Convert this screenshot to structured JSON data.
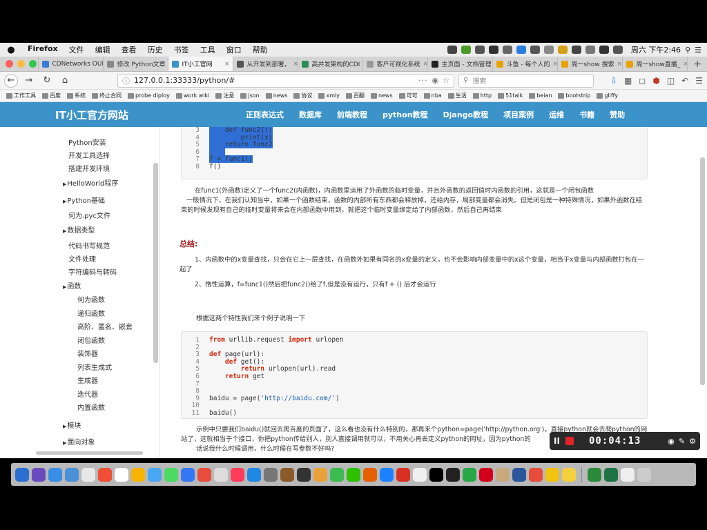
{
  "menubar": {
    "apple": "",
    "items": [
      "Firefox",
      "文件",
      "编辑",
      "查看",
      "历史",
      "书签",
      "工具",
      "窗口",
      "帮助"
    ],
    "clock": "周六 下午2:46",
    "tray_colors": [
      "#444",
      "#4c9a2a",
      "#555",
      "#333",
      "#666",
      "#2b7de0",
      "#555",
      "#888",
      "#d4a017",
      "#444",
      "#777",
      "#333",
      "#555"
    ]
  },
  "tabs": [
    {
      "label": "CDNetworks OUI",
      "color": "#3a7bd5"
    },
    {
      "label": "修改 Python文章 | D",
      "color": "#888"
    },
    {
      "label": "IT小工官网",
      "color": "#3b93c9",
      "active": true
    },
    {
      "label": "从开发到部署，",
      "color": "#555"
    },
    {
      "label": "高并发架构的CDI",
      "color": "#2e8b57"
    },
    {
      "label": "客户可视化系统",
      "color": "#999"
    },
    {
      "label": "主页面 - 文档管理",
      "color": "#222"
    },
    {
      "label": "斗鱼 - 每个人的",
      "color": "#e8a400"
    },
    {
      "label": "周一show 搜索",
      "color": "#e8a400"
    },
    {
      "label": "周一show直播_",
      "color": "#e8a400"
    }
  ],
  "nav": {
    "url": "127.0.0.1:33333/python/#",
    "url_more": "···",
    "search_placeholder": "搜索"
  },
  "bookmarks": [
    "工作工具",
    "百度",
    "系统",
    "终止合同",
    "probe diploy",
    "work wiki",
    "注意",
    "json",
    "news",
    "协议",
    "xmly",
    "百翻",
    "news",
    "可可",
    "nba",
    "生活",
    "http",
    "51talk",
    "beian",
    "bootstrip",
    "gliffy"
  ],
  "site": {
    "title": "IT小工官方网站",
    "nav": [
      "正则表达式",
      "数据库",
      "前端教程",
      "python教程",
      "Django教程",
      "项目案例",
      "运维",
      "书籍",
      "赞助"
    ]
  },
  "sidebar": [
    {
      "label": "Python安装",
      "type": "sub"
    },
    {
      "label": "开发工具选择",
      "type": "sub"
    },
    {
      "label": "搭建开发环境",
      "type": "sub"
    },
    {
      "label": "HelloWorld程序",
      "type": "group"
    },
    {
      "label": "Python基础",
      "type": "group"
    },
    {
      "label": "何为.pyc文件",
      "type": "sub"
    },
    {
      "label": "数据类型",
      "type": "group"
    },
    {
      "label": "代码书写规范",
      "type": "sub"
    },
    {
      "label": "文件处理",
      "type": "sub"
    },
    {
      "label": "字符编码与转码",
      "type": "sub"
    },
    {
      "label": "函数",
      "type": "group"
    },
    {
      "label": "何为函数",
      "type": "sub2"
    },
    {
      "label": "递归函数",
      "type": "sub2"
    },
    {
      "label": "高阶、匿名、嵌套",
      "type": "sub2"
    },
    {
      "label": "闭包函数",
      "type": "sub2"
    },
    {
      "label": "装饰器",
      "type": "sub2"
    },
    {
      "label": "列表生成式",
      "type": "sub2"
    },
    {
      "label": "生成器",
      "type": "sub2"
    },
    {
      "label": "迭代器",
      "type": "sub2"
    },
    {
      "label": "内置函数",
      "type": "sub2"
    },
    {
      "label": "模块",
      "type": "group"
    },
    {
      "label": "面向对象",
      "type": "group"
    }
  ],
  "code1": {
    "lines": [
      {
        "n": "3",
        "text": "    def func2():",
        "hl": true
      },
      {
        "n": "4",
        "text": "        print(x)",
        "hl": true
      },
      {
        "n": "5",
        "text": "    return func2",
        "hl": true
      },
      {
        "n": "6",
        "text": "    ",
        "hl": true
      },
      {
        "n": "7",
        "text": "f = func1()",
        "hl": true
      },
      {
        "n": "8",
        "text": "f()",
        "hl": false
      }
    ]
  },
  "para1": "在func1(外函数)定义了一个func2(内函数)，内函数里运用了外函数的临时变量，并且外函数的返回值时内函数的引用，这就是一个闭包函数",
  "para2": "一般情况下，在我们认知当中，如果一个函数结束，函数的内部所有东西都会释放掉，还给内存，局部变量都会消失。但是闭包是一种特殊情况，如果外函数在结束的时候发现有自己的临时变量将来会在内部函数中用到，就把这个临时变量绑定给了内部函数，然后自己再结束",
  "summary_title": "总结:",
  "summary1": "1、内函数中的x变量查找，只会在它上一层查找，在函数外如果有同名的x变量的定义，也不会影响内部变量中的x这个变量，相当于x变量与内部函数打包在一起了",
  "summary2": "2、惰性运算，f=func1()然后把func2()给了f,但是没有运行，只有f + () 后才会运行",
  "example_intro": "根据这两个特性我们来个例子说明一下",
  "code2": {
    "lines": [
      {
        "n": "1",
        "text": "from urllib.request import urlopen"
      },
      {
        "n": "2",
        "text": ""
      },
      {
        "n": "3",
        "text": "def page(url):"
      },
      {
        "n": "4",
        "text": "    def get():"
      },
      {
        "n": "5",
        "text": "        return urlopen(url).read"
      },
      {
        "n": "6",
        "text": "    return get"
      },
      {
        "n": "7",
        "text": ""
      },
      {
        "n": "8",
        "text": ""
      },
      {
        "n": "9",
        "text": "baidu = page('http://baidu.com/')"
      },
      {
        "n": "10",
        "text": ""
      },
      {
        "n": "11",
        "text": "baidu()"
      }
    ]
  },
  "bottom_para1": "示例中只要我们baidu()就回去爬百度的页面了，这么看也没有什么特别的，那再来个python=page('http://python.org')，直接python就会去爬python的网站了，这就相当于个接口，你把python传给别人，别人直接调用就可以，不用关心再去定义python的网址，因为python的",
  "bottom_para2": "话说我什么时候调用，什么时候在写参数不好吗?",
  "recorder": {
    "time": "00:04:13",
    "pause": "II"
  },
  "dock_colors": [
    "#2b6fd1",
    "#6a4bbf",
    "#3a8ee6",
    "#4a90d9",
    "#e8e8e8",
    "#f04e37",
    "#ffffff",
    "#f5b400",
    "#48a7f2",
    "#4cd964",
    "#3478f6",
    "#e74c3c",
    "#dcdcdc",
    "#ff3b5c",
    "#1e88e5",
    "#777",
    "#8a5a2b",
    "#333",
    "#e9a23b",
    "#3cba54",
    "#2dc100",
    "#e66000",
    "#1d82ff",
    "#d93025",
    "#f0f0f0",
    "#000000",
    "#222",
    "#27a745",
    "#d4001a",
    "#c8a97e",
    "#2b579a",
    "#e74c3c",
    "#f1c40f",
    "#f4d03f",
    "#2a8a3a",
    "#1f7244",
    "#eee",
    "#ccc"
  ]
}
